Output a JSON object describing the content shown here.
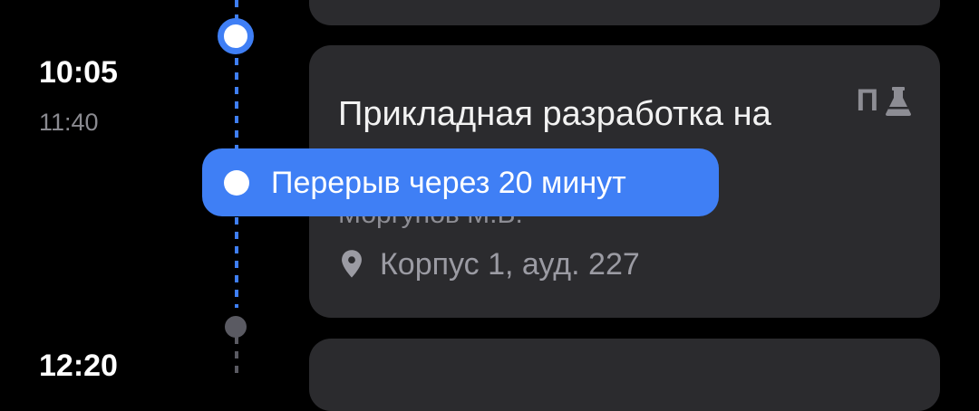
{
  "timeline": {
    "current_start": "10:05",
    "current_end": "11:40",
    "next_start": "12:20"
  },
  "lesson": {
    "title": "Прикладная разработка на Python",
    "teacher": "Моргунов М.В.",
    "location": "Корпус 1, ауд. 227",
    "type_label": "П",
    "type_icon": "flask-icon",
    "location_icon": "location-pin-icon"
  },
  "break_notice": {
    "text": "Перерыв через 20 минут"
  },
  "colors": {
    "accent": "#3f7ff5",
    "card_bg": "#2b2b2e",
    "background": "#000000",
    "inactive": "#5a5a62"
  }
}
